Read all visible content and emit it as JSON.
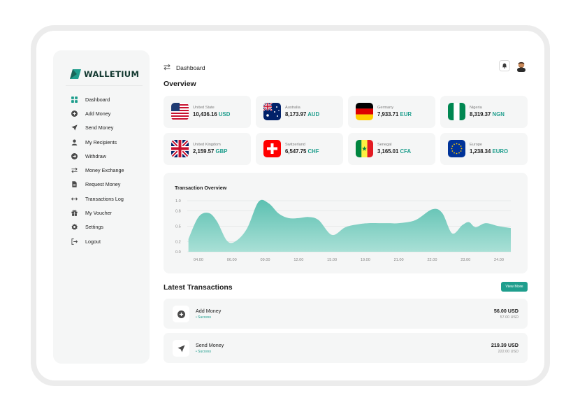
{
  "app": {
    "name": "WALLETIUM",
    "brand_color": "#1f9e8d",
    "dark_brand_color": "#12382f"
  },
  "sidebar": {
    "items": [
      {
        "label": "Dashboard",
        "icon": "grid-icon"
      },
      {
        "label": "Add Money",
        "icon": "plus-circle-icon"
      },
      {
        "label": "Send Money",
        "icon": "send-icon"
      },
      {
        "label": "My Recipients",
        "icon": "user-icon"
      },
      {
        "label": "Withdraw",
        "icon": "arrow-circle-icon"
      },
      {
        "label": "Money Exchange",
        "icon": "exchange-icon"
      },
      {
        "label": "Request Money",
        "icon": "document-icon"
      },
      {
        "label": "Transactions Log",
        "icon": "arrows-horizontal-icon"
      },
      {
        "label": "My Voucher",
        "icon": "gift-icon"
      },
      {
        "label": "Settings",
        "icon": "gear-icon"
      },
      {
        "label": "Logout",
        "icon": "logout-icon"
      }
    ]
  },
  "header": {
    "title": "Dashboard",
    "icons": [
      "swap-icon",
      "bell-icon",
      "avatar"
    ]
  },
  "overview": {
    "title": "Overview",
    "cards": [
      {
        "country": "United State",
        "amount": "10,436.16",
        "currency": "USD",
        "flag": "us-flag-icon"
      },
      {
        "country": "Australia",
        "amount": "8,173.97",
        "currency": "AUD",
        "flag": "au-flag-icon"
      },
      {
        "country": "Germany",
        "amount": "7,933.71",
        "currency": "EUR",
        "flag": "de-flag-icon"
      },
      {
        "country": "Nigeria",
        "amount": "8,319.37",
        "currency": "NGN",
        "flag": "ng-flag-icon"
      },
      {
        "country": "United Kingdom",
        "amount": "2,159.57",
        "currency": "GBP",
        "flag": "gb-flag-icon"
      },
      {
        "country": "Switzerland",
        "amount": "6,547.75",
        "currency": "CHF",
        "flag": "ch-flag-icon"
      },
      {
        "country": "Senegal",
        "amount": "3,165.01",
        "currency": "CFA",
        "flag": "sn-flag-icon"
      },
      {
        "country": "Europe",
        "amount": "1,238.34",
        "currency": "EURO",
        "flag": "eu-flag-icon"
      }
    ]
  },
  "chart_data": {
    "type": "area",
    "title": "Transaction Overview",
    "xlabel": "",
    "ylabel": "",
    "categories": [
      "04.00",
      "06.00",
      "09.00",
      "12.00",
      "15.00",
      "19.00",
      "21.00",
      "22.00",
      "23.00",
      "24.00"
    ],
    "y_ticks": [
      "1.0",
      "0.8",
      "0.5",
      "0.2",
      "0.0"
    ],
    "ylim": [
      0,
      1
    ],
    "grid": true,
    "fill_color": "#5cc0b1",
    "x": [
      -0.3,
      0,
      0.3,
      0.55,
      0.85,
      1.1,
      1.45,
      1.8,
      2.1,
      2.4,
      2.7,
      3.0,
      3.3,
      3.6,
      4.0,
      4.4,
      4.8,
      5.1,
      5.4,
      5.7,
      6.0,
      6.5,
      7.0,
      7.3,
      7.6,
      7.9,
      8.1,
      8.3,
      8.6,
      9.0,
      9.4
    ],
    "values": [
      0.25,
      0.68,
      0.76,
      0.6,
      0.22,
      0.2,
      0.45,
      0.98,
      0.95,
      0.75,
      0.66,
      0.66,
      0.68,
      0.62,
      0.33,
      0.48,
      0.54,
      0.56,
      0.56,
      0.56,
      0.56,
      0.62,
      0.83,
      0.76,
      0.36,
      0.52,
      0.58,
      0.48,
      0.56,
      0.5,
      0.46
    ]
  },
  "latest": {
    "title": "Latest Transactions",
    "view_more": "View More",
    "transactions": [
      {
        "name": "Add Money",
        "status": "• Success",
        "amount": "56.00 USD",
        "sub": "57.00 USD",
        "icon": "plus-circle-icon"
      },
      {
        "name": "Send Money",
        "status": "• Success",
        "amount": "219.39 USD",
        "sub": "222.00 USD",
        "icon": "send-icon"
      }
    ]
  }
}
